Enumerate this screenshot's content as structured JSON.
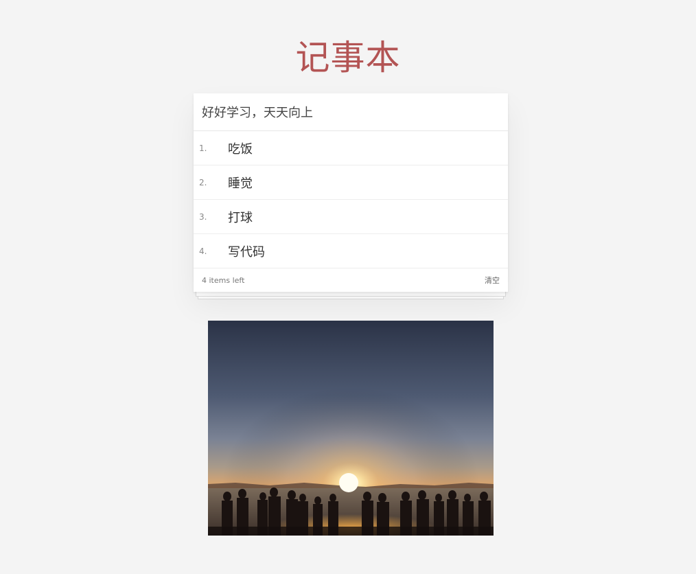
{
  "app": {
    "title": "记事本"
  },
  "input": {
    "value": "好好学习，天天向上"
  },
  "todos": [
    {
      "index": "1.",
      "label": "吃饭"
    },
    {
      "index": "2.",
      "label": "睡觉"
    },
    {
      "index": "3.",
      "label": "打球"
    },
    {
      "index": "4.",
      "label": "写代码"
    }
  ],
  "footer": {
    "count_text": "4 items left",
    "clear_label": "清空"
  },
  "colors": {
    "title": "#b35454",
    "background": "#f4f4f4"
  }
}
